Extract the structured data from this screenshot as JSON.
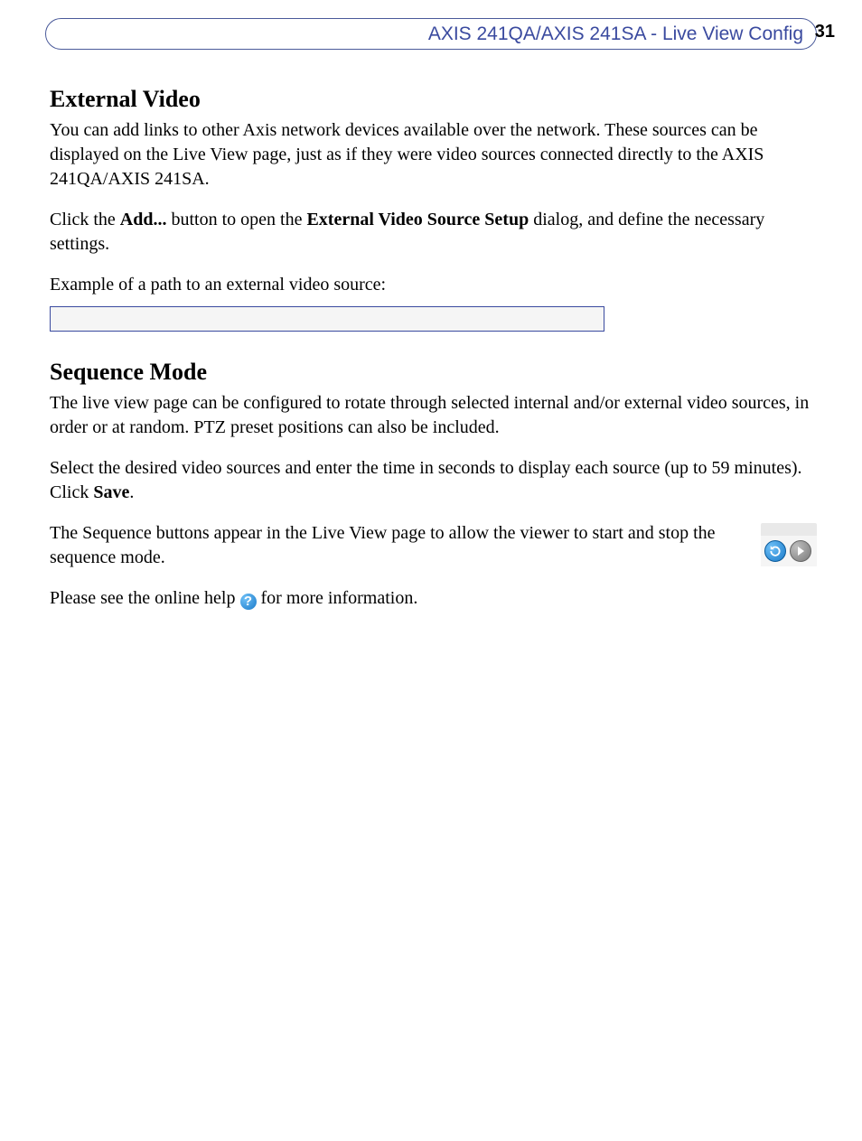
{
  "header": {
    "title": "AXIS 241QA/AXIS 241SA - Live View Config",
    "page_number": "31"
  },
  "section1": {
    "heading": "External Video",
    "p1": "You can add links to other Axis network devices available over the network. These sources can be displayed on the Live View page, just as if they were video sources connected directly to the AXIS 241QA/AXIS 241SA.",
    "p2_a": "Click the ",
    "p2_b": "Add...",
    "p2_c": " button to open the ",
    "p2_d": "External Video Source Setup",
    "p2_e": " dialog, and define the necessary settings.",
    "p3": "Example of a path to an external video source:"
  },
  "section2": {
    "heading": "Sequence Mode",
    "p1": "The live view page can be configured to rotate through selected internal and/or external video sources, in order or at random. PTZ preset positions can also be included.",
    "p2_a": "Select the desired video sources and enter the time in seconds to display each source (up to 59 minutes). Click ",
    "p2_b": "Save",
    "p2_c": ".",
    "p3": "The Sequence buttons appear in the Live View page to allow the viewer to start and stop the sequence mode.",
    "p4_a": "Please see the online help ",
    "p4_b": " for more information."
  },
  "icons": {
    "help": "?",
    "refresh": "refresh-icon",
    "play": "play-icon"
  }
}
